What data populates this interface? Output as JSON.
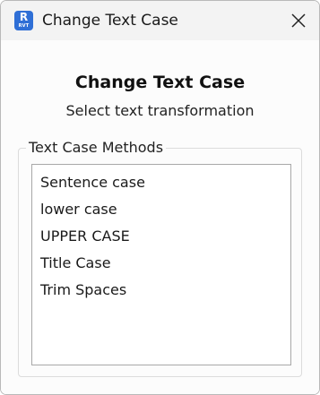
{
  "window": {
    "title": "Change Text Case",
    "icon": {
      "name": "revit-app-icon",
      "letter": "R",
      "sublabel": "RVT",
      "color": "#2f6fd6"
    }
  },
  "dialog": {
    "heading": "Change Text Case",
    "subheading": "Select text transformation"
  },
  "group": {
    "label": "Text Case Methods",
    "items": [
      {
        "label": "Sentence case"
      },
      {
        "label": "lower case"
      },
      {
        "label": "UPPER CASE"
      },
      {
        "label": "Title Case"
      },
      {
        "label": "Trim Spaces"
      }
    ]
  }
}
